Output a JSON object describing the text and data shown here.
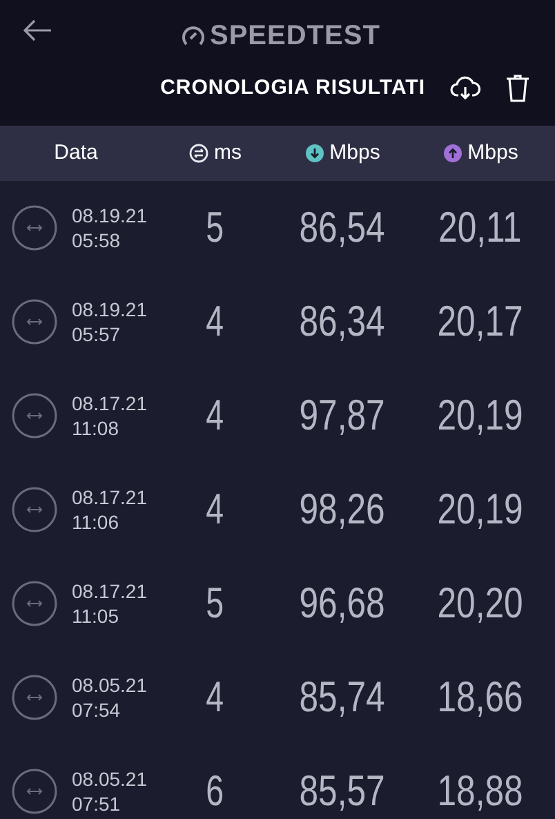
{
  "app": {
    "logo": "SPEEDTEST",
    "title": "CRONOLOGIA RISULTATI"
  },
  "table": {
    "columns": [
      {
        "label": "Data"
      },
      {
        "label": "ms"
      },
      {
        "label": "Mbps"
      },
      {
        "label": "Mbps"
      }
    ],
    "rows": [
      {
        "date": "08.19.21",
        "time": "05:58",
        "ping": "5",
        "download": "86,54",
        "upload": "20,11"
      },
      {
        "date": "08.19.21",
        "time": "05:57",
        "ping": "4",
        "download": "86,34",
        "upload": "20,17"
      },
      {
        "date": "08.17.21",
        "time": "11:08",
        "ping": "4",
        "download": "97,87",
        "upload": "20,19"
      },
      {
        "date": "08.17.21",
        "time": "11:06",
        "ping": "4",
        "download": "98,26",
        "upload": "20,19"
      },
      {
        "date": "08.17.21",
        "time": "11:05",
        "ping": "5",
        "download": "96,68",
        "upload": "20,20"
      },
      {
        "date": "08.05.21",
        "time": "07:54",
        "ping": "4",
        "download": "85,74",
        "upload": "18,66"
      },
      {
        "date": "08.05.21",
        "time": "07:51",
        "ping": "6",
        "download": "85,57",
        "upload": "18,88"
      }
    ]
  }
}
